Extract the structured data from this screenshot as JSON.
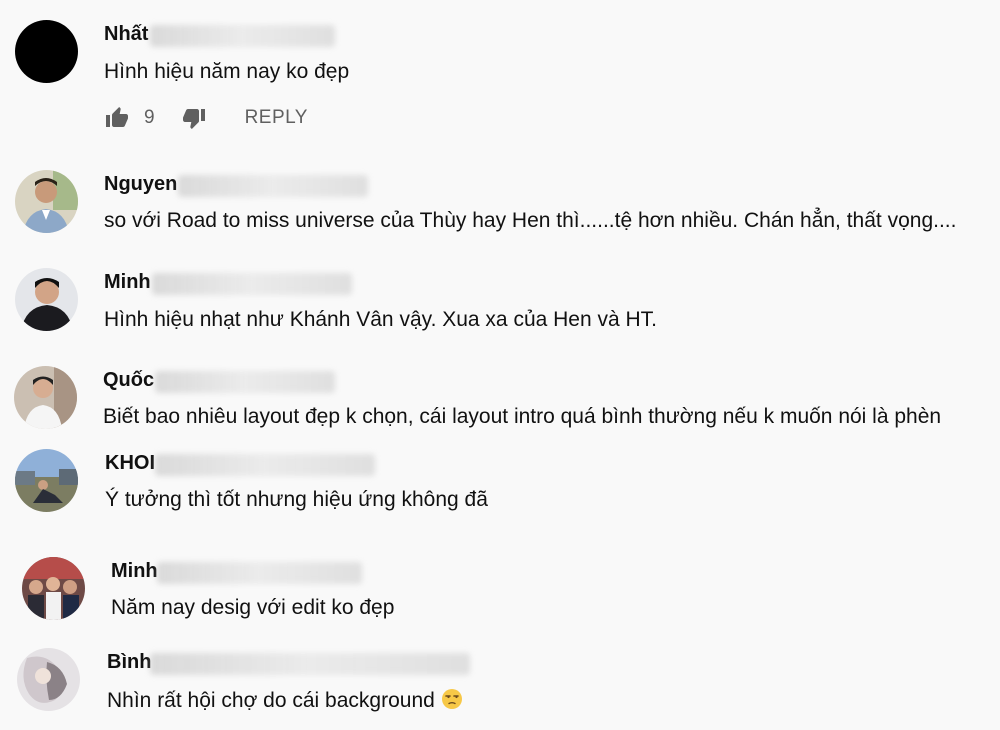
{
  "comments": [
    {
      "author": "Nhất",
      "text": "Hình hiệu năm nay ko đẹp",
      "likes": "9",
      "reply_label": "REPLY",
      "avatar_color": "#000000"
    },
    {
      "author": "Nguyen",
      "text": "so với Road to miss universe của Thùy hay Hen thì......tệ hơn nhiều. Chán hẳn, thất vọng....",
      "avatar_color": "#c9c2b0"
    },
    {
      "author": "Minh",
      "text": "Hình hiệu nhạt như Khánh Vân vậy. Xua xa của Hen và HT.",
      "avatar_color": "#3a3a3a"
    },
    {
      "author": "Quốc",
      "text": "Biết bao nhiêu layout đẹp k chọn, cái layout intro quá bình thường nếu k muốn nói là phèn",
      "avatar_color": "#b8a898"
    },
    {
      "author": "KHOI",
      "text": "Ý tưởng thì tốt nhưng hiệu ứng không đã",
      "avatar_color": "#7a93b8"
    },
    {
      "author": "Minh",
      "text": "Năm nay desig với edit ko đẹp",
      "avatar_color": "#8a5b4e"
    },
    {
      "author": "Bình",
      "text": "Nhìn rất hội chợ do cái background",
      "emoji": "unamused-face",
      "avatar_color": "#d7d2d6"
    }
  ]
}
